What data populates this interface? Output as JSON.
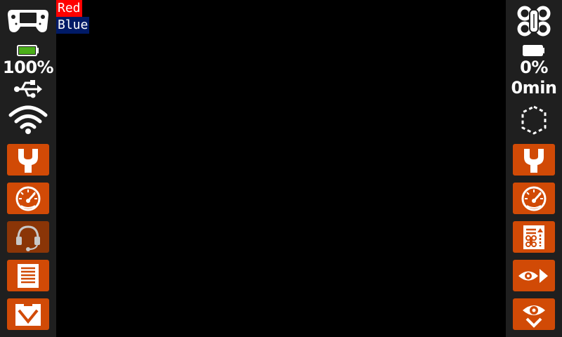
{
  "colors": {
    "sidebar_bg": "#1f1f1f",
    "button_orange": "#d14a06",
    "button_dim": "#8a3507",
    "battery_green": "#4caf1a",
    "red_label_bg": "#ff0000",
    "blue_label_bg": "#001a66"
  },
  "left": {
    "controller_icon": "game-controller-icon",
    "battery_icon": "battery-icon",
    "battery_level": 1.0,
    "battery_pct": "100%",
    "usb_icon": "usb-icon",
    "wifi_icon": "wifi-icon",
    "buttons": [
      {
        "icon": "wrench-icon",
        "dim": false
      },
      {
        "icon": "speedometer-icon",
        "dim": false
      },
      {
        "icon": "headset-icon",
        "dim": true
      },
      {
        "icon": "document-icon",
        "dim": false
      },
      {
        "icon": "download-icon",
        "dim": false
      }
    ]
  },
  "right": {
    "drone_icon": "drone-icon",
    "battery_icon": "battery-icon",
    "battery_level": 0.0,
    "battery_pct": "0%",
    "flight_time": "0min",
    "shield_icon": "hexagon-dashed-icon",
    "buttons": [
      {
        "icon": "wrench-icon",
        "dim": false
      },
      {
        "icon": "speedometer-icon",
        "dim": false
      },
      {
        "icon": "drone-log-icon",
        "dim": false
      },
      {
        "icon": "eye-forward-icon",
        "dim": false
      },
      {
        "icon": "eye-download-icon",
        "dim": false
      }
    ]
  },
  "overlay": {
    "red_label": "Red",
    "blue_label": "Blue"
  }
}
